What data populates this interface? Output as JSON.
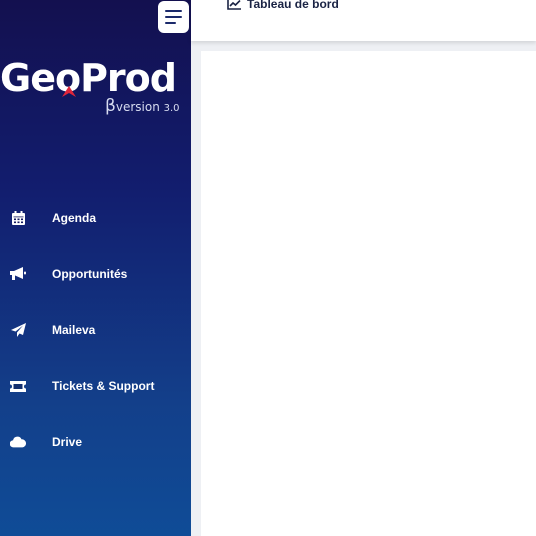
{
  "sidebar": {
    "logo": {
      "brand": "GeoProd",
      "beta_symbol": "β",
      "version_label": "version",
      "version_number": "3.0"
    },
    "menu_toggle_icon": "hamburger-menu-icon",
    "items": [
      {
        "label": "Agenda",
        "icon": "calendar-icon"
      },
      {
        "label": "Opportunités",
        "icon": "megaphone-icon"
      },
      {
        "label": "Maileva",
        "icon": "paper-plane-icon"
      },
      {
        "label": "Tickets & Support",
        "icon": "ticket-icon"
      },
      {
        "label": "Drive",
        "icon": "cloud-icon"
      }
    ],
    "colors": {
      "gradient_top": "#13104f",
      "gradient_bottom": "#0f4c97"
    }
  },
  "topbar": {
    "breadcrumb": {
      "label": "Tableau de bord",
      "icon": "line-chart-icon"
    }
  },
  "accent_color": "#1b2a6b"
}
